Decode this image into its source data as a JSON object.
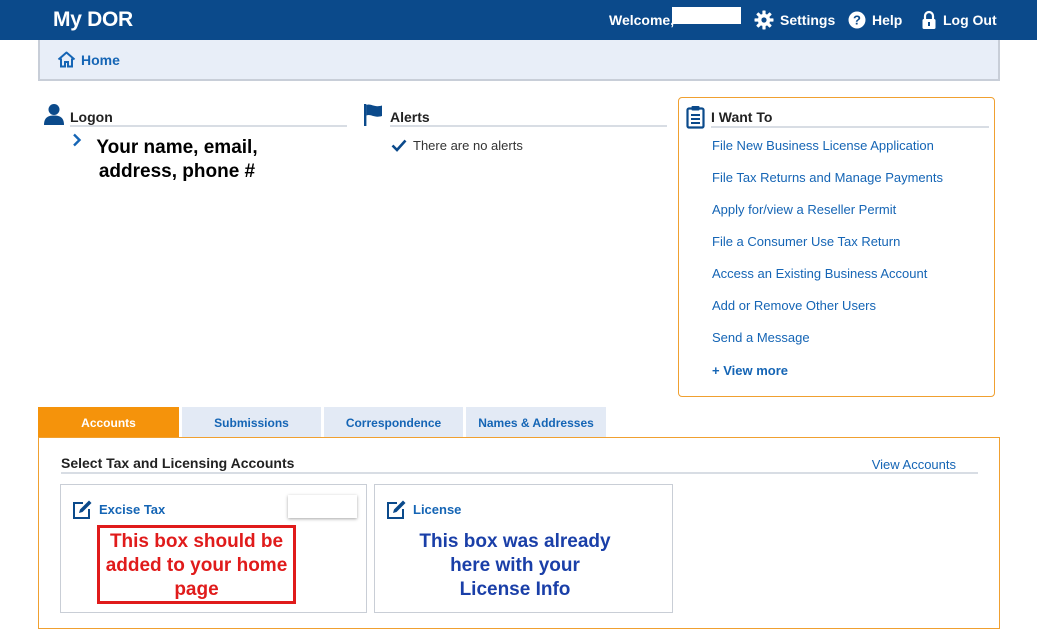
{
  "topbar": {
    "brand": "My DOR",
    "welcome": "Welcome,",
    "settings": "Settings",
    "help": "Help",
    "logout": "Log Out",
    "bg_color": "#0b4a8b"
  },
  "breadcrumb": {
    "home": "Home"
  },
  "logon": {
    "title": "Logon",
    "annotation": "Your name, email, address, phone #"
  },
  "alerts": {
    "title": "Alerts",
    "message": "There are no alerts"
  },
  "iwant": {
    "title": "I Want To",
    "items": [
      "File New Business License Application",
      "File Tax Returns and Manage Payments",
      "Apply for/view a Reseller Permit",
      "File a Consumer Use Tax Return",
      "Access an Existing Business Account",
      "Add or Remove Other Users",
      "Send a Message"
    ],
    "view_more": "+ View more"
  },
  "tabs": [
    "Accounts",
    "Submissions",
    "Correspondence",
    "Names & Addresses"
  ],
  "accounts": {
    "title": "Select Tax and Licensing Accounts",
    "view_accounts": "View Accounts",
    "cards": [
      {
        "title": "Excise Tax",
        "annotation": "This box should be added to your home page"
      },
      {
        "title": "License",
        "annotation": "This box was already here with your License Info"
      }
    ]
  },
  "colors": {
    "accent_orange": "#f5930b",
    "link_blue": "#1565b5",
    "annotation_red": "#e01b1b",
    "annotation_blue": "#1a3fa8"
  },
  "icons": {
    "settings": "gear-icon",
    "help": "question-circle-icon",
    "logout": "lock-icon",
    "home": "home-icon",
    "logon": "user-icon",
    "alerts": "flag-icon",
    "alert_row": "checkmark-icon",
    "iwant": "clipboard-icon",
    "card": "edit-icon"
  }
}
